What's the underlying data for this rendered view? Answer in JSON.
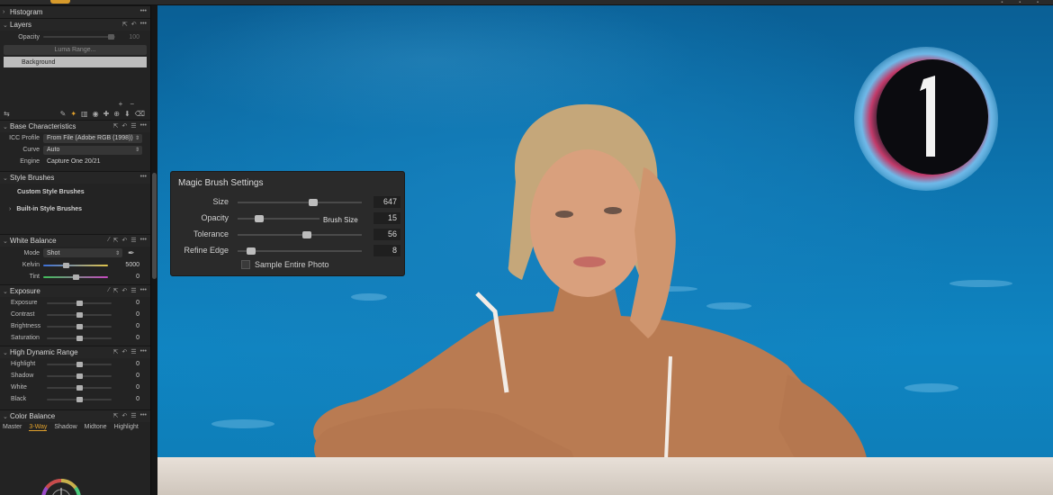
{
  "panels": {
    "histogram": "Histogram",
    "layers": {
      "title": "Layers",
      "opacity_label": "Opacity",
      "opacity_value": "100",
      "luma_range": "Luma Range...",
      "background_layer": "Background"
    },
    "base_characteristics": {
      "title": "Base Characteristics",
      "icc_label": "ICC Profile",
      "icc_value": "From File (Adobe RGB (1998))",
      "curve_label": "Curve",
      "curve_value": "Auto",
      "engine_label": "Engine",
      "engine_value": "Capture One 20/21"
    },
    "style_brushes": {
      "title": "Style Brushes",
      "custom": "Custom Style Brushes",
      "builtin": "Built-in Style Brushes"
    },
    "white_balance": {
      "title": "White Balance",
      "mode_label": "Mode",
      "mode_value": "Shot",
      "kelvin_label": "Kelvin",
      "kelvin_value": "5000",
      "tint_label": "Tint",
      "tint_value": "0"
    },
    "exposure": {
      "title": "Exposure",
      "rows": [
        {
          "label": "Exposure",
          "value": "0"
        },
        {
          "label": "Contrast",
          "value": "0"
        },
        {
          "label": "Brightness",
          "value": "0"
        },
        {
          "label": "Saturation",
          "value": "0"
        }
      ]
    },
    "hdr": {
      "title": "High Dynamic Range",
      "rows": [
        {
          "label": "Highlight",
          "value": "0"
        },
        {
          "label": "Shadow",
          "value": "0"
        },
        {
          "label": "White",
          "value": "0"
        },
        {
          "label": "Black",
          "value": "0"
        }
      ]
    },
    "color_balance": {
      "title": "Color Balance",
      "tabs": [
        "Master",
        "3-Way",
        "Shadow",
        "Midtone",
        "Highlight"
      ],
      "active_tab": "3-Way"
    }
  },
  "magic_brush": {
    "title": "Magic Brush Settings",
    "rows": [
      {
        "label": "Size",
        "value": "647",
        "level": 0.62
      },
      {
        "label": "Opacity",
        "value": "15",
        "level": 0.15
      },
      {
        "label": "Tolerance",
        "value": "56",
        "level": 0.56
      },
      {
        "label": "Refine Edge",
        "value": "8",
        "level": 0.08
      }
    ],
    "tooltip": "Brush Size",
    "sample_label": "Sample Entire Photo"
  },
  "colors": {
    "accent": "#d79a2b",
    "panel": "#232323",
    "pool": "#0f85c2"
  }
}
